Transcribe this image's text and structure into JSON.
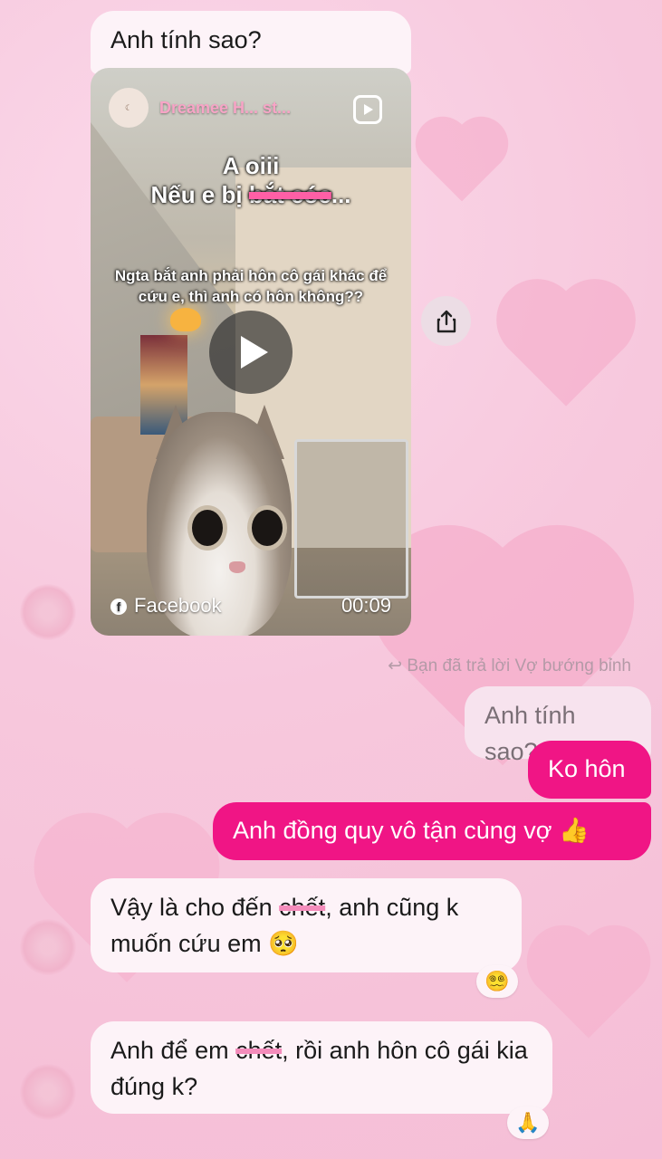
{
  "messages": {
    "m1_text": "Anh tính sao?",
    "video": {
      "channel_name": "Dreamee H... st...",
      "caption_line1": "A oiii",
      "caption_line2_prefix": "Nếu e bị ",
      "caption_line2_struck": "bắt cóc",
      "caption_line2_suffix": "...",
      "subcaption": "Ngta bắt anh phải hôn cô gái khác để cứu e, thì anh có hôn không??",
      "source": "Facebook",
      "duration": "00:09"
    },
    "reply_note": "Bạn đã trả lời Vợ bướng bỉnh",
    "quoted_text": "Anh tính sao?",
    "out1": "Ko hôn",
    "out2": "Anh đồng quy vô tận cùng vợ 👍",
    "in2_part1": "Vậy là cho đến ",
    "in2_struck": "chết",
    "in2_part2": ", anh cũng k muốn cứu em 🥺",
    "in2_reaction": "😵‍💫",
    "in3_part1": "Anh để em ",
    "in3_struck": "chết",
    "in3_part2": ", rồi anh hôn cô gái kia đúng k?",
    "in3_reaction": "🙏"
  },
  "colors": {
    "outgoing_bubble": "#f01585",
    "incoming_bubble": "#fdf3f8",
    "background": "#f7c8dd"
  },
  "icons": [
    "share-icon",
    "reply-arrow-icon",
    "play-icon",
    "facebook-icon",
    "reels-icon"
  ]
}
